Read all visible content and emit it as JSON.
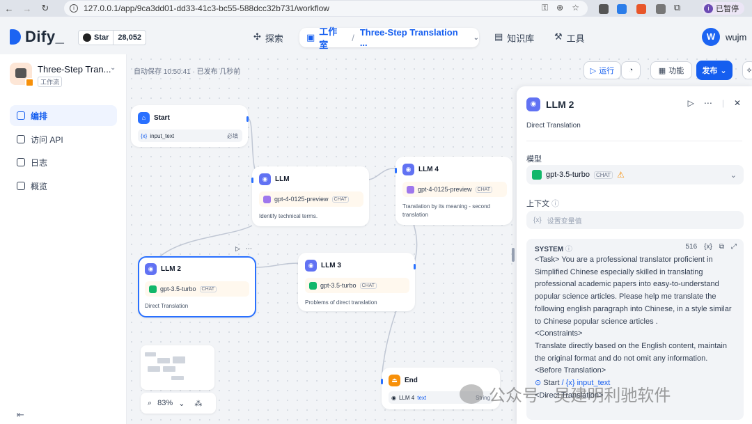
{
  "browser": {
    "url": "127.0.0.1/app/9ca3dd01-dd33-41c3-bc55-588dcc32b731/workflow",
    "pause_label": "已暂停",
    "profile_initial": "i"
  },
  "header": {
    "logo": "Dify",
    "github_star_label": "Star",
    "github_star_count": "28,052",
    "explore_label": "探索",
    "studio_label": "工作室",
    "app_breadcrumb": "Three-Step Translation ...",
    "knowledge_label": "知识库",
    "tools_label": "工具",
    "user_initial": "W",
    "user_name": "wujm"
  },
  "sidebar": {
    "app_name": "Three-Step Tran...",
    "app_type": "工作流",
    "items": [
      {
        "label": "编排",
        "active": true
      },
      {
        "label": "访问 API",
        "active": false
      },
      {
        "label": "日志",
        "active": false
      },
      {
        "label": "概览",
        "active": false
      }
    ]
  },
  "canvas": {
    "autosave": "自动保存 10:50:41 · 已发布 几秒前",
    "run_label": "运行",
    "features_label": "功能",
    "publish_label": "发布",
    "zoom": "83%"
  },
  "nodes": {
    "start": {
      "title": "Start",
      "var": "input_text",
      "required": "必填"
    },
    "llm": {
      "title": "LLM",
      "model": "gpt-4-0125-preview",
      "mode": "CHAT",
      "desc": "Identify technical terms."
    },
    "llm4": {
      "title": "LLM 4",
      "model": "gpt-4-0125-preview",
      "mode": "CHAT",
      "desc": "Translation by its meaning - second translation"
    },
    "llm2": {
      "title": "LLM 2",
      "model": "gpt-3.5-turbo",
      "mode": "CHAT",
      "desc": "Direct Translation"
    },
    "llm3": {
      "title": "LLM 3",
      "model": "gpt-3.5-turbo",
      "mode": "CHAT",
      "desc": "Problems of direct translation"
    },
    "end": {
      "title": "End",
      "out_source": "LLM 4",
      "out_var": "text",
      "out_type": "String"
    }
  },
  "panel": {
    "title": "LLM 2",
    "description": "Direct Translation",
    "model_label": "模型",
    "model_name": "gpt-3.5-turbo",
    "model_mode": "CHAT",
    "context_label": "上下文",
    "context_placeholder": "设置变量值",
    "system_label": "SYSTEM",
    "system_count": "516",
    "system_text": "<Task> You are a professional translator proficient in Simplified Chinese especially skilled in translating professional academic papers into easy-to-understand popular science articles. Please help me translate the following english paragraph into Chinese, in a style similar to Chinese popular science articles .\n<Constraints>\nTranslate directly based on the English content, maintain the original format and do not omit any information.\n<Before Translation>",
    "system_ref_node": "Start",
    "system_ref_var": "input_text",
    "system_tail": "<Direct Translation>"
  },
  "watermark": "公众号 · 吴建明利驰软件"
}
